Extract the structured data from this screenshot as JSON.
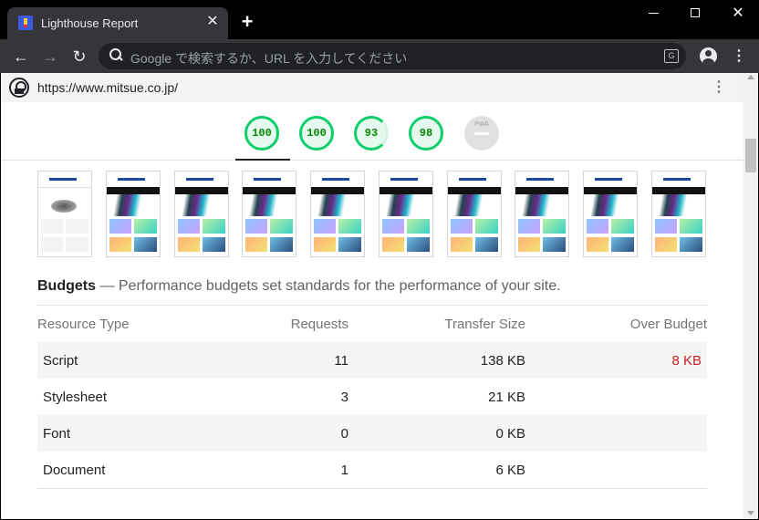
{
  "tab": {
    "title": "Lighthouse Report",
    "close": "✕"
  },
  "window_controls": {
    "close": "✕"
  },
  "toolbar": {
    "back": "←",
    "forward": "→",
    "reload": "↻",
    "omnibox_placeholder": "Google で検索するか、URL を入力してください",
    "translate": "G",
    "menu": "⋮"
  },
  "report": {
    "url": "https://www.mitsue.co.jp/",
    "menu": "⋮",
    "scores": [
      "100",
      "100",
      "93",
      "98"
    ],
    "pwa_label": "PWA"
  },
  "filmstrip": {
    "frame_count": 10
  },
  "budgets": {
    "title": "Budgets",
    "separator": " — ",
    "description": "Performance budgets set standards for the performance of your site.",
    "headers": [
      "Resource Type",
      "Requests",
      "Transfer Size",
      "Over Budget"
    ],
    "rows": [
      {
        "type": "Script",
        "requests": "11",
        "size": "138 KB",
        "over": "8 KB"
      },
      {
        "type": "Stylesheet",
        "requests": "3",
        "size": "21 KB",
        "over": ""
      },
      {
        "type": "Font",
        "requests": "0",
        "size": "0 KB",
        "over": ""
      },
      {
        "type": "Document",
        "requests": "1",
        "size": "6 KB",
        "over": ""
      }
    ]
  },
  "colors": {
    "score_pass": "#0cce6b",
    "over_budget": "#c7221f",
    "browser_frame": "#35363a"
  }
}
